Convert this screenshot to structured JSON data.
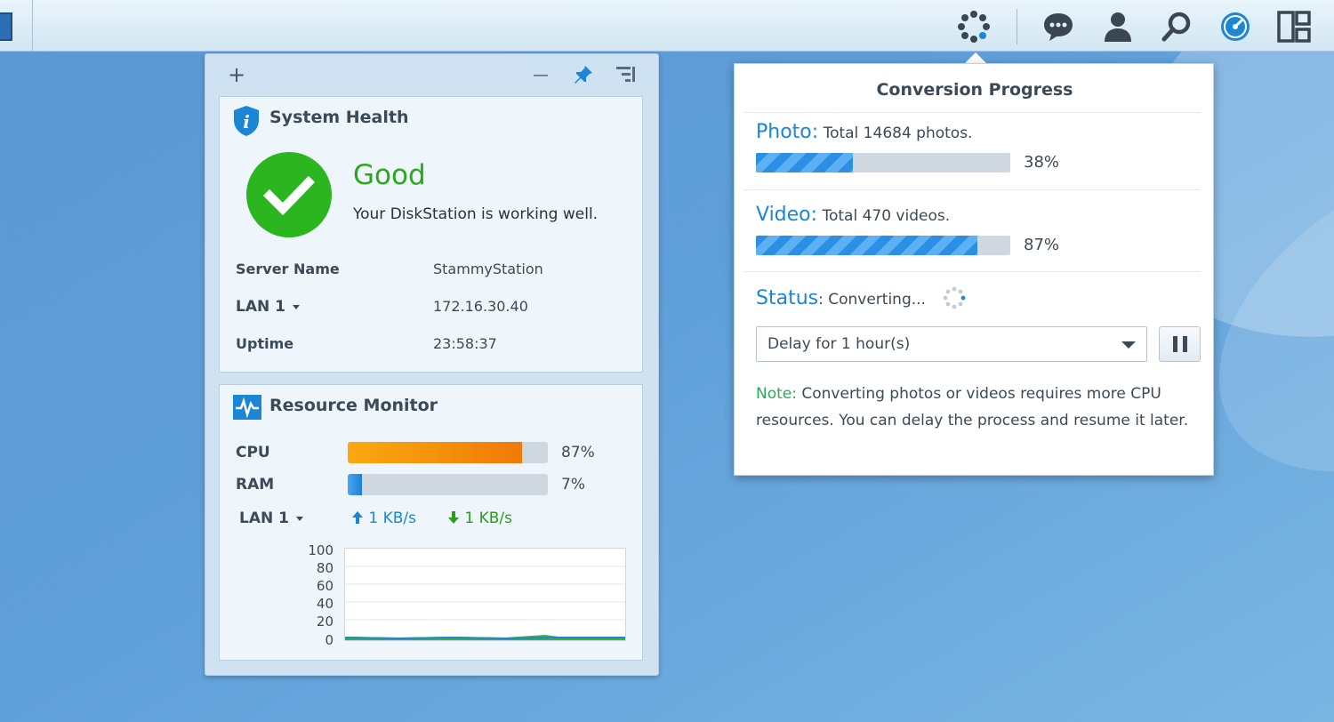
{
  "taskbar": {
    "icons": [
      "conversion-progress-icon",
      "chat-icon",
      "user-icon",
      "search-icon",
      "resource-monitor-icon",
      "widgets-icon"
    ]
  },
  "widgets_toolbar": {
    "add": "+",
    "minimize": "—"
  },
  "system_health": {
    "title": "System Health",
    "status": "Good",
    "message": "Your DiskStation is working well.",
    "rows": [
      {
        "label": "Server Name",
        "value": "StammyStation"
      },
      {
        "label": "LAN 1",
        "value": "172.16.30.40"
      },
      {
        "label": "Uptime",
        "value": "23:58:37"
      }
    ]
  },
  "resource_monitor": {
    "title": "Resource Monitor",
    "cpu": {
      "label": "CPU",
      "pct_text": "87%",
      "value": 87
    },
    "ram": {
      "label": "RAM",
      "pct_text": "7%",
      "value": 7
    },
    "network": {
      "label": "LAN 1",
      "up": "1 KB/s",
      "down": "1 KB/s"
    },
    "chart": {
      "yticks": [
        "100",
        "80",
        "60",
        "40",
        "20",
        "0"
      ]
    }
  },
  "conversion": {
    "title": "Conversion Progress",
    "photo": {
      "key": "Photo:",
      "text": "Total 14684 photos.",
      "pct_text": "38%",
      "value": 38
    },
    "video": {
      "key": "Video:",
      "text": "Total 470 videos.",
      "pct_text": "87%",
      "value": 87
    },
    "status": {
      "key": "Status",
      "text": ": Converting..."
    },
    "delay": {
      "selected": "Delay for 1 hour(s)"
    },
    "note": {
      "key": "Note:",
      "text": " Converting photos or videos requires more CPU resources. You can delay the process and resume it later."
    }
  },
  "colors": {
    "good": "#2bb620",
    "accent": "#1b86d6",
    "cpu_bar": "#f07a07",
    "ram_bar": "#1d7fd8",
    "note": "#2bab59"
  }
}
